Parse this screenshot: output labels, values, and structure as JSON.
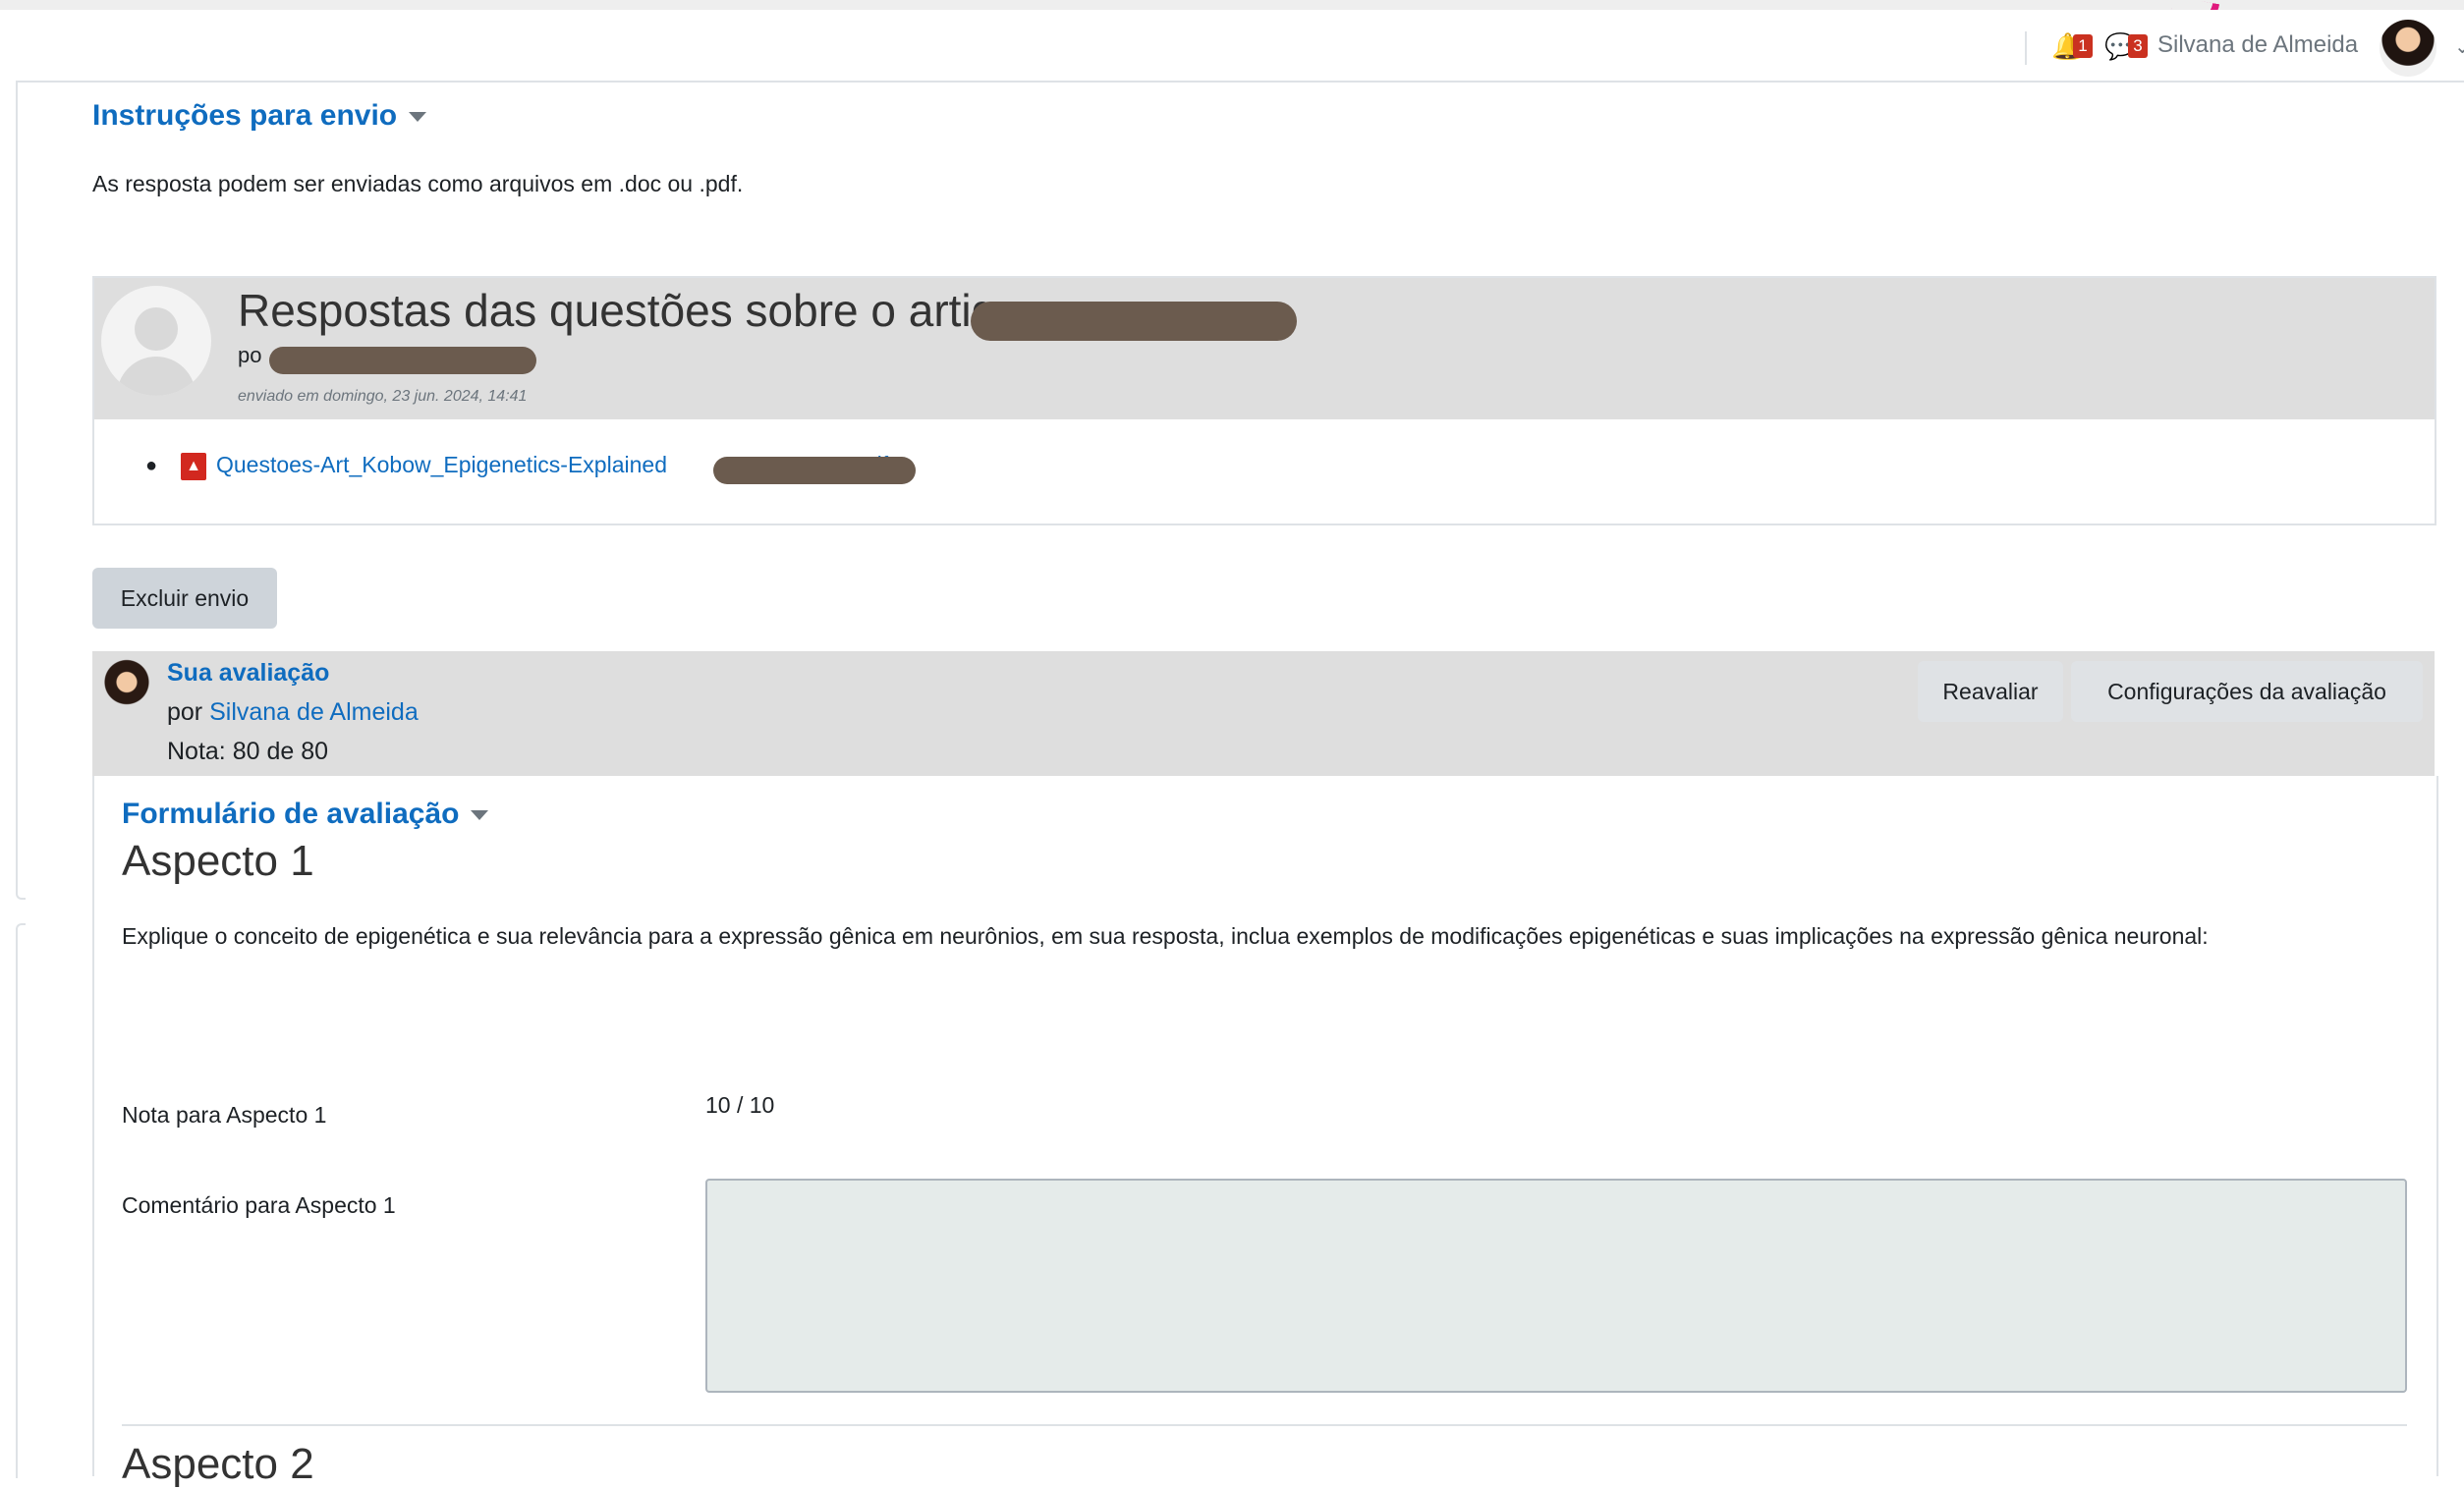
{
  "header": {
    "notifications_count": "1",
    "messages_count": "3",
    "user_name": "Silvana de Almeida"
  },
  "instructions": {
    "title": "Instruções para envio",
    "text": "As resposta podem ser enviadas como arquivos em .doc ou .pdf."
  },
  "submission": {
    "title": "Respostas das questões sobre o artigo -",
    "by_prefix": "po",
    "date": "enviado em domingo, 23 jun. 2024, 14:41",
    "file_name": "Questoes-Art_Kobow_Epigenetics-Explained",
    "file_suffix": "df"
  },
  "buttons": {
    "delete_submission": "Excluir envio",
    "reassess": "Reavaliar",
    "assessment_settings": "Configurações da avaliação"
  },
  "assessment": {
    "title": "Sua avaliação",
    "by_label": "por",
    "assessor": "Silvana de Almeida",
    "grade": "Nota: 80 de 80"
  },
  "form": {
    "title": "Formulário de avaliação",
    "aspect1_title": "Aspecto 1",
    "aspect1_description": "Explique o conceito de epigenética e sua relevância para a expressão gênica em neurônios, em sua resposta, inclua exemplos de modificações epigenéticas e suas implicações na expressão gênica neuronal:",
    "aspect1_grade_label": "Nota para Aspecto 1",
    "aspect1_grade_value": "10 / 10",
    "aspect1_comment_label": "Comentário para Aspecto 1",
    "aspect1_comment_value": "",
    "aspect2_title": "Aspecto 2"
  },
  "icons": {
    "bell": "bell-icon",
    "chat": "chat-icon",
    "pdf": "pdf-file-icon",
    "chevron": "chevron-down-icon"
  },
  "colors": {
    "link": "#0f6cbf",
    "badge": "#ca3120",
    "header_gray": "#dedede"
  }
}
